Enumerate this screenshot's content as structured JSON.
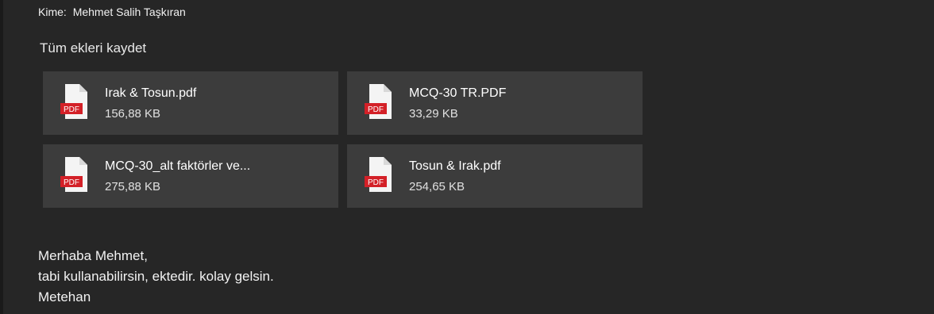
{
  "header": {
    "to_label": "Kime:",
    "to_value": "Mehmet Salih Taşkıran"
  },
  "attachments_section": {
    "save_all_label": "Tüm ekleri kaydet",
    "items": [
      {
        "name": "Irak & Tosun.pdf",
        "size": "156,88 KB",
        "icon": "pdf-file-icon",
        "icon_text": "PDF"
      },
      {
        "name": "MCQ-30 TR.PDF",
        "size": "33,29 KB",
        "icon": "pdf-file-icon",
        "icon_text": "PDF"
      },
      {
        "name": "MCQ-30_alt faktörler ve...",
        "size": "275,88 KB",
        "icon": "pdf-file-icon",
        "icon_text": "PDF"
      },
      {
        "name": "Tosun & Irak.pdf",
        "size": "254,65 KB",
        "icon": "pdf-file-icon",
        "icon_text": "PDF"
      }
    ]
  },
  "message": {
    "lines": [
      "Merhaba Mehmet,",
      "tabi kullanabilirsin, ektedir. kolay gelsin.",
      "Metehan"
    ]
  },
  "colors": {
    "background": "#262626",
    "attachment_tile": "#3c3c3c",
    "pdf_red": "#d32027",
    "text": "#ffffff"
  }
}
